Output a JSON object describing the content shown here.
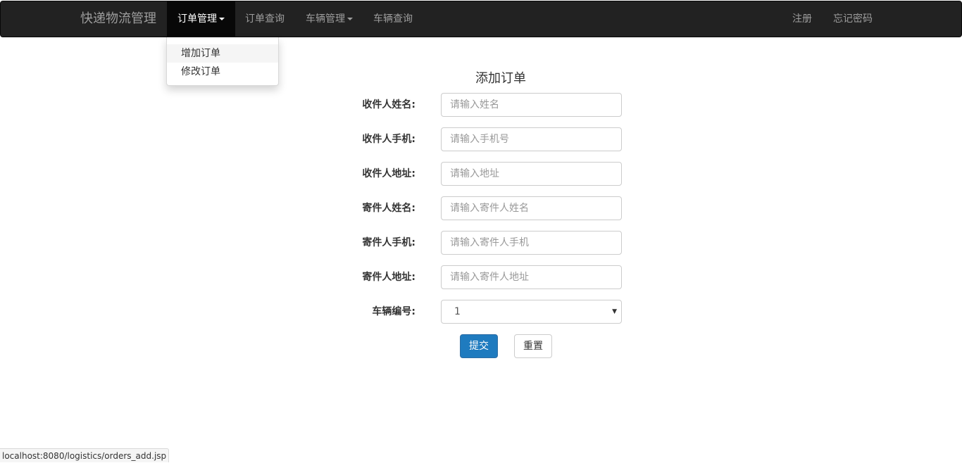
{
  "navbar": {
    "brand": "快递物流管理",
    "items": [
      {
        "label": "订单管理",
        "dropdown": true,
        "active": true
      },
      {
        "label": "订单查询"
      },
      {
        "label": "车辆管理",
        "dropdown": true
      },
      {
        "label": "车辆查询"
      }
    ],
    "right_items": [
      {
        "label": "注册"
      },
      {
        "label": "忘记密码"
      }
    ]
  },
  "dropdown": {
    "items": [
      {
        "label": "增加订单"
      },
      {
        "label": "修改订单"
      }
    ]
  },
  "form": {
    "title": "添加订单",
    "fields": [
      {
        "label": "收件人姓名:",
        "placeholder": "请输入姓名",
        "value": ""
      },
      {
        "label": "收件人手机:",
        "placeholder": "请输入手机号",
        "value": ""
      },
      {
        "label": "收件人地址:",
        "placeholder": "请输入地址",
        "value": ""
      },
      {
        "label": "寄件人姓名:",
        "placeholder": "请输入寄件人姓名",
        "value": ""
      },
      {
        "label": "寄件人手机:",
        "placeholder": "请输入寄件人手机",
        "value": ""
      },
      {
        "label": "寄件人地址:",
        "placeholder": "请输入寄件人地址",
        "value": ""
      }
    ],
    "vehicle": {
      "label": "车辆编号:",
      "selected": "1"
    },
    "submit_label": "提交",
    "reset_label": "重置"
  },
  "status_bar": {
    "url": "localhost:8080/logistics/orders_add.jsp"
  },
  "colors": {
    "navbar_bg": "#222222",
    "primary_button": "#1f7bbf"
  }
}
